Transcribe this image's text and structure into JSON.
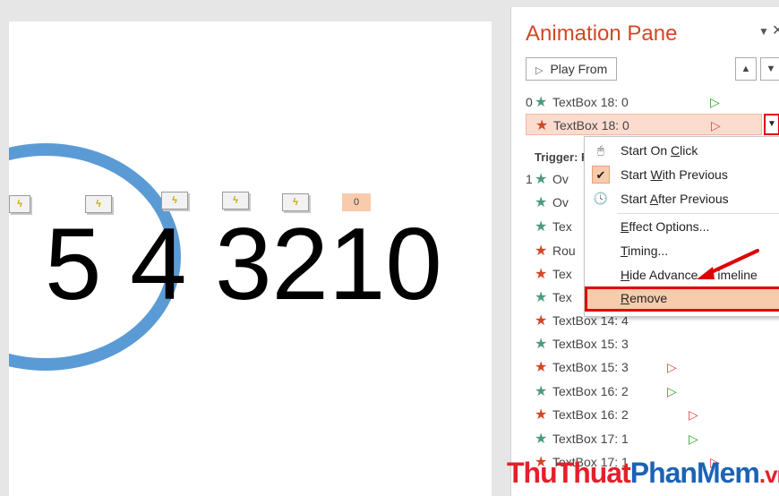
{
  "slide": {
    "tags": [
      "",
      "",
      "",
      "",
      "",
      "0"
    ],
    "digits": "5 4 3210"
  },
  "pane": {
    "title": "Animation Pane",
    "play_from_label": "Play From",
    "rows": [
      {
        "num": "0",
        "label": "TextBox 18: 0",
        "star": "green",
        "trigger": "green"
      },
      {
        "num": "",
        "label": "TextBox 18: 0",
        "star": "red",
        "trigger": "red"
      }
    ],
    "trigger_label": "Trigger: F",
    "partial_rows": [
      {
        "num": "1",
        "label": "Ov",
        "star": "green"
      },
      {
        "num": "",
        "label": "Ov",
        "star": "green"
      },
      {
        "num": "",
        "label": "Tex",
        "star": "green"
      },
      {
        "num": "",
        "label": "Rou",
        "star": "red"
      },
      {
        "num": "",
        "label": "Tex",
        "star": "red"
      },
      {
        "num": "",
        "label": "Tex",
        "star": "green"
      }
    ],
    "lower_rows": [
      {
        "label": "TextBox 14: 4",
        "star": "red",
        "trigger": ""
      },
      {
        "label": "TextBox 15: 3",
        "star": "green",
        "trigger": ""
      },
      {
        "label": "TextBox 15: 3",
        "star": "red",
        "trigger": "red"
      },
      {
        "label": "TextBox 16: 2",
        "star": "green",
        "trigger": "green"
      },
      {
        "label": "TextBox 16: 2",
        "star": "red",
        "trigger": "red"
      },
      {
        "label": "TextBox 17: 1",
        "star": "green",
        "trigger": "green"
      },
      {
        "label": "TextBox 17: 1",
        "star": "red",
        "trigger": "red"
      }
    ]
  },
  "context_menu": {
    "start_on_click": {
      "pre": "Start On ",
      "u": "C",
      "post": "lick"
    },
    "start_with_previous": {
      "pre": "Start ",
      "u": "W",
      "post": "ith Previous"
    },
    "start_after_previous": {
      "pre": "Start ",
      "u": "A",
      "post": "fter Previous"
    },
    "effect_options": {
      "pre": "",
      "u": "E",
      "post": "ffect Options..."
    },
    "timing": {
      "pre": "",
      "u": "T",
      "post": "iming..."
    },
    "hide_timeline": {
      "pre": "",
      "u": "H",
      "post": "ide Advance"
    },
    "hide_timeline_tail": "imeline",
    "remove": {
      "pre": "",
      "u": "R",
      "post": "emove"
    }
  },
  "watermark": {
    "part1": "ThuThuat",
    "part2": "PhanMem",
    "part3": ".vn"
  },
  "colors": {
    "accent": "#d24726",
    "highlight": "#f8cbad",
    "annotation_red": "#e00000",
    "ring_blue": "#5b9bd5"
  }
}
